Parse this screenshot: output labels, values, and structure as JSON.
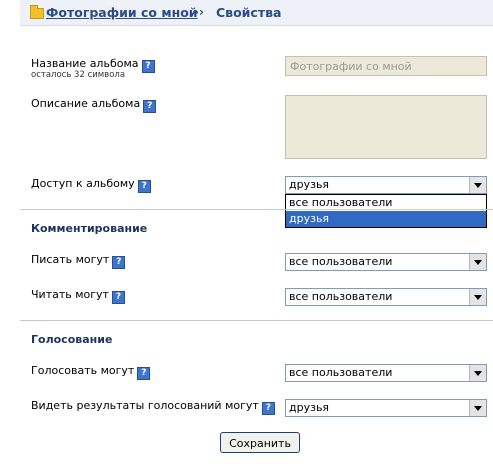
{
  "breadcrumb": {
    "album_link": "Фотографии со мной",
    "separator": "››",
    "current": "Свойства"
  },
  "help_glyph": "?",
  "album_name": {
    "label": "Название альбома",
    "remaining": "осталось 32 символа",
    "value": "Фотографии со мной"
  },
  "album_description": {
    "label": "Описание альбома",
    "value": ""
  },
  "access": {
    "label": "Доступ к альбому",
    "selected": "друзья",
    "options": [
      "все пользователи",
      "друзья"
    ]
  },
  "comments": {
    "heading": "Комментирование",
    "write": {
      "label": "Писать могут",
      "selected": "все пользователи"
    },
    "read": {
      "label": "Читать могут",
      "selected": "все пользователи"
    }
  },
  "voting": {
    "heading": "Голосование",
    "vote": {
      "label": "Голосовать могут",
      "selected": "все пользователи"
    },
    "results": {
      "label": "Видеть результаты голосований могут",
      "selected": "друзья"
    }
  },
  "save_button": "Сохранить",
  "colors": {
    "header_bg": "#eef1f8",
    "link": "#2b4c86",
    "selection": "#316ac5",
    "disabled_field": "#ece9d8"
  }
}
